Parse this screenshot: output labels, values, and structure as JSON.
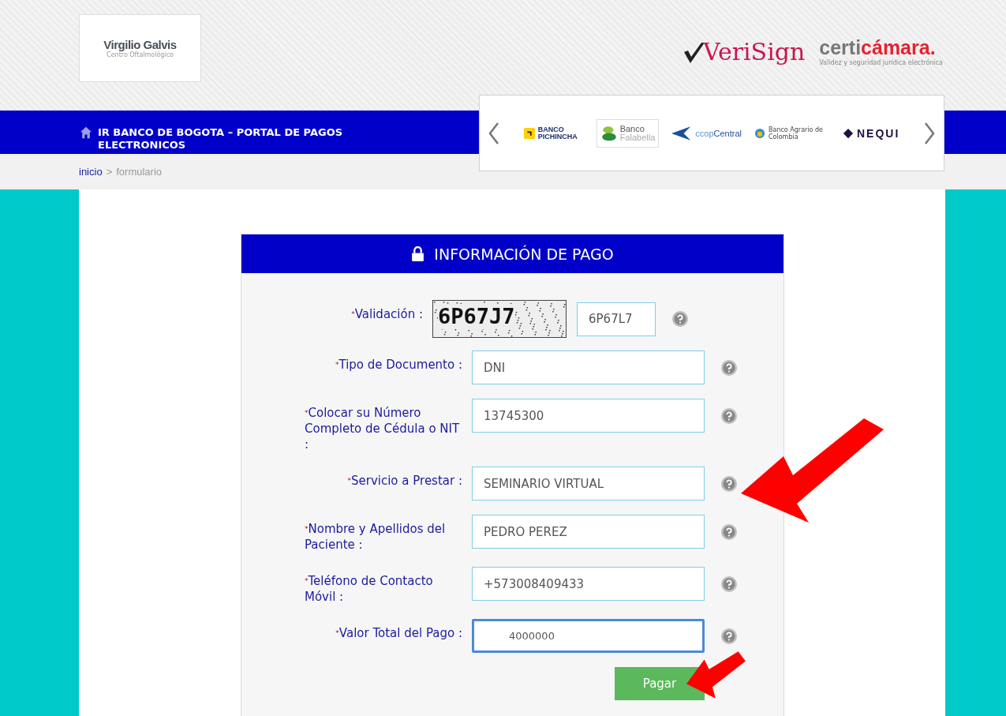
{
  "header": {
    "logo": {
      "name": "Virgilio Galvis",
      "tagline": "Centro Oftalmológico"
    },
    "trust_logos": [
      {
        "kind": "verisign",
        "text": "VeriSign"
      },
      {
        "kind": "certicamara",
        "text": "certi",
        "accent": "cámara.",
        "tagline": "Validez y seguridad jurídica electrónica"
      }
    ]
  },
  "nav": {
    "title": "IR BANCO DE BOGOTA – PORTAL DE PAGOS ELECTRONICOS"
  },
  "banks": [
    {
      "kind": "pichincha",
      "text": "BANCO PICHINCHA"
    },
    {
      "kind": "falabella",
      "text": "Banco",
      "sub": "Falabella"
    },
    {
      "kind": "coopcentral",
      "text": "Central",
      "pre": "ccop"
    },
    {
      "kind": "agrario",
      "text": "Banco Agrario de Colombia"
    },
    {
      "kind": "nequi",
      "text": "NEQUI"
    }
  ],
  "breadcrumb": [
    {
      "label": "inicio",
      "link": true
    },
    {
      "label": ">",
      "link": false
    },
    {
      "label": "formulario",
      "link": false
    }
  ],
  "form": {
    "title": "INFORMACIÓN DE PAGO",
    "fields": [
      {
        "kind": "captcha",
        "mark": "*",
        "label": "Validación :",
        "captcha": "6P67J7",
        "value": "6P67L7",
        "focused": false
      },
      {
        "kind": "text",
        "mark": "*",
        "label": "Tipo de Documento :",
        "value": "DNI",
        "focused": false
      },
      {
        "kind": "text",
        "mark": "*",
        "label": "Colocar su Número Completo de Cédula o NIT :",
        "value": "13745300",
        "focused": false
      },
      {
        "kind": "text",
        "mark": "*",
        "label": "Servicio a Prestar :",
        "value": "SEMINARIO VIRTUAL",
        "focused": false
      },
      {
        "kind": "text",
        "mark": "*",
        "label": "Nombre y Apellidos del Paciente :",
        "value": "PEDRO PEREZ",
        "focused": false
      },
      {
        "kind": "text",
        "mark": "*",
        "label": "Teléfono de Contacto Móvil :",
        "value": "+573008409433",
        "focused": false
      },
      {
        "kind": "amount",
        "mark": "*",
        "label": "Valor Total del Pago :",
        "value": "4000000",
        "focused": true
      }
    ],
    "submit": "Pagar"
  }
}
